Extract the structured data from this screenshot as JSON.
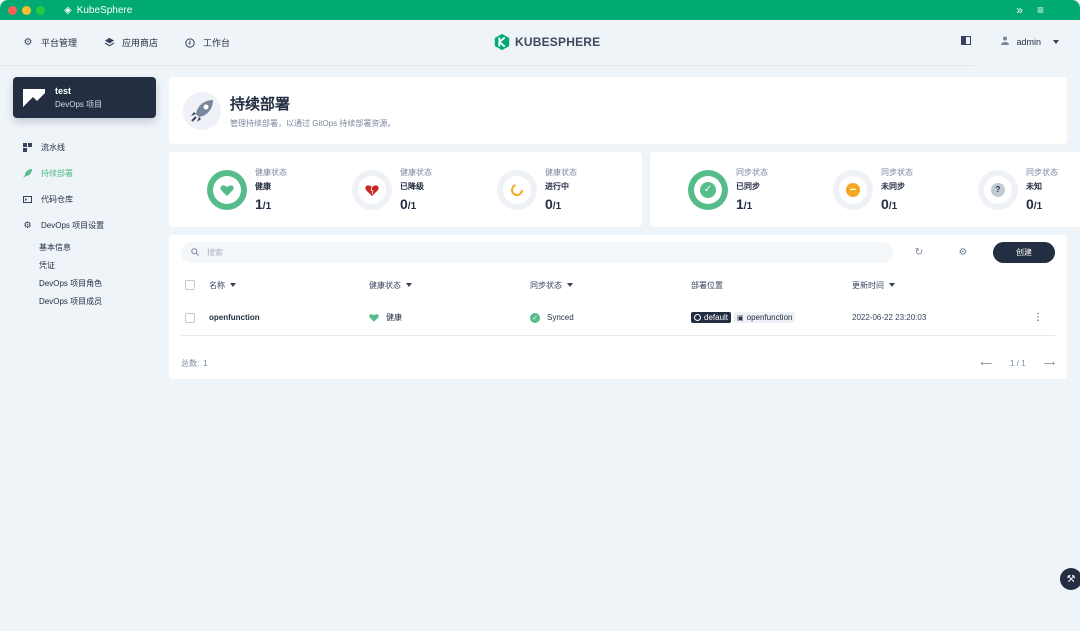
{
  "window": {
    "title": "KubeSphere"
  },
  "header": {
    "nav": [
      {
        "label": "平台管理",
        "icon": "gear-icon"
      },
      {
        "label": "应用商店",
        "icon": "layers-icon"
      },
      {
        "label": "工作台",
        "icon": "workbench-icon"
      }
    ],
    "logo": "KUBESPHERE",
    "user": "admin"
  },
  "sidebar": {
    "project": {
      "name": "test",
      "type": "DevOps 项目"
    },
    "items": [
      {
        "label": "流水线",
        "icon": "pipeline-icon"
      },
      {
        "label": "持续部署",
        "icon": "rocket-icon",
        "active": true
      },
      {
        "label": "代码仓库",
        "icon": "code-repo-icon"
      },
      {
        "label": "DevOps 项目设置",
        "icon": "gear-icon"
      }
    ],
    "subitems": [
      "基本信息",
      "凭证",
      "DevOps 项目角色",
      "DevOps 项目成员"
    ]
  },
  "banner": {
    "title": "持续部署",
    "description": "管理持续部署，以通过 GitOps 持续部署资源。"
  },
  "stats": {
    "health": [
      {
        "label": "健康状态",
        "value": "健康",
        "count": "1",
        "total": "/1",
        "color": "#55bc8a",
        "icon": "heart-icon"
      },
      {
        "label": "健康状态",
        "value": "已降级",
        "count": "0",
        "total": "/1",
        "color": "#ca2621",
        "icon": "broken-heart-icon"
      },
      {
        "label": "健康状态",
        "value": "进行中",
        "count": "0",
        "total": "/1",
        "color": "#f5a623",
        "icon": "spinner-icon"
      }
    ],
    "sync": [
      {
        "label": "同步状态",
        "value": "已同步",
        "count": "1",
        "total": "/1",
        "color": "#55bc8a",
        "icon": "check-icon"
      },
      {
        "label": "同步状态",
        "value": "未同步",
        "count": "0",
        "total": "/1",
        "color": "#f5a623",
        "icon": "minus-icon"
      },
      {
        "label": "同步状态",
        "value": "未知",
        "count": "0",
        "total": "/1",
        "color": "#79879c",
        "icon": "question-icon"
      }
    ]
  },
  "table": {
    "search_placeholder": "搜索",
    "create_label": "创建",
    "columns": [
      "名称",
      "健康状态",
      "同步状态",
      "部署位置",
      "更新时间"
    ],
    "rows": [
      {
        "name": "openfunction",
        "health": "健康",
        "sync": "Synced",
        "cluster": "default",
        "namespace": "openfunction",
        "updated": "2022-06-22 23:20:03"
      }
    ],
    "total_label": "总数:",
    "total": "1",
    "page": "1 / 1"
  }
}
